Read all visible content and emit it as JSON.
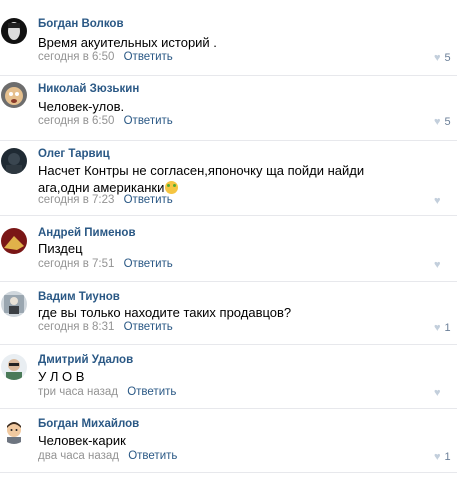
{
  "comments": [
    {
      "author": "Богдан Волков",
      "text": "Время акуительных историй .",
      "time": "сегодня в 6:50",
      "reply": "Ответить",
      "likes": "5"
    },
    {
      "author": "Николай Зюзькин",
      "text": "Человек-улов.",
      "time": "сегодня в 6:50",
      "reply": "Ответить",
      "likes": "5"
    },
    {
      "author": "Олег Тарвиц",
      "text": "Насчет Контры не согласен,японочку ща пойди найди ага,одни американки",
      "time": "сегодня в 7:23",
      "reply": "Ответить",
      "likes": ""
    },
    {
      "author": "Андрей Пименов",
      "text": "Пиздец",
      "time": "сегодня в 7:51",
      "reply": "Ответить",
      "likes": ""
    },
    {
      "author": "Вадим Тиунов",
      "text": "где вы только находите таких продавцов?",
      "time": "сегодня в 8:31",
      "reply": "Ответить",
      "likes": "1"
    },
    {
      "author": "Дмитрий Удалов",
      "text": "У Л О В",
      "time": "три часа назад",
      "reply": "Ответить",
      "likes": ""
    },
    {
      "author": "Богдан Михайлов",
      "text": "Человек-карик",
      "time": "два часа назад",
      "reply": "Ответить",
      "likes": "1"
    }
  ],
  "icons": {
    "like": "heart-icon",
    "emoji": "smiley-icon"
  },
  "colors": {
    "author": "#2a5885",
    "time": "#939393",
    "like": "#c3cfdc",
    "divider": "#e7e8ec"
  }
}
